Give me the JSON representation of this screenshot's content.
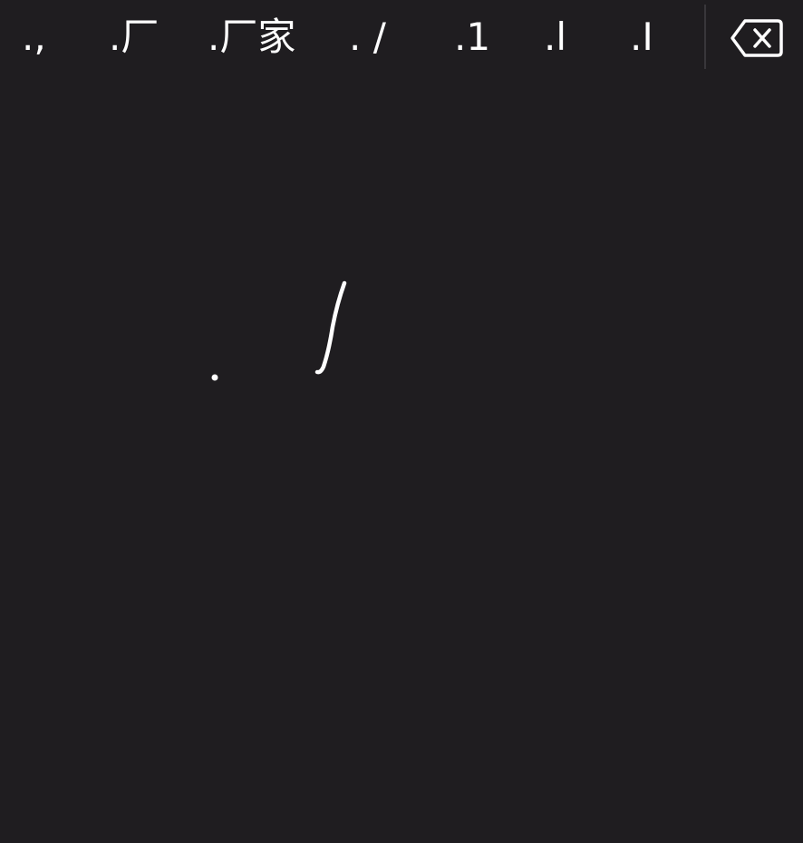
{
  "candidates": [
    {
      "label": ".,"
    },
    {
      "label": ".厂"
    },
    {
      "label": ".厂家"
    },
    {
      "label": ". /"
    },
    {
      "label": ".1"
    },
    {
      "label": ".l"
    },
    {
      "label": ".I"
    }
  ],
  "icons": {
    "delete": "backspace-icon"
  },
  "colors": {
    "background": "#1f1d20",
    "ink": "#ffffff",
    "divider": "#38363a"
  }
}
